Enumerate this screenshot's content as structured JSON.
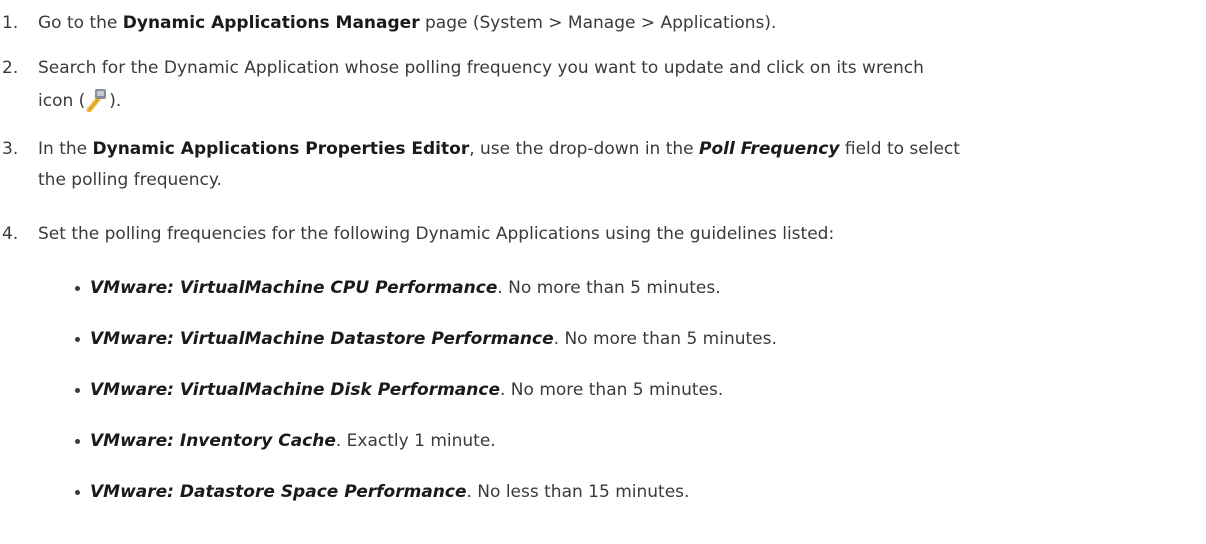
{
  "steps": [
    {
      "number": "1.",
      "before": "Go to the ",
      "bold": "Dynamic Applications Manager",
      "after": " page (System > Manage > Applications)."
    },
    {
      "number": "2.",
      "line1": "Search for the Dynamic Application whose polling frequency you want to update and click on its wrench",
      "line2_before": "icon (",
      "icon": "wrench-icon",
      "line2_after": ")."
    },
    {
      "number": "3.",
      "before": "In the ",
      "bold": "Dynamic Applications Properties Editor",
      "middle": ", use the drop-down in the ",
      "bold_italic": "Poll Frequency",
      "after": " field to select",
      "line2": "the polling frequency."
    },
    {
      "number": "4.",
      "text": "Set the polling frequencies for the following Dynamic Applications using the guidelines listed:"
    }
  ],
  "bullets": [
    {
      "name": "VMware: VirtualMachine CPU Performance",
      "guideline": ". No more than 5 minutes."
    },
    {
      "name": "VMware: VirtualMachine Datastore Performance",
      "guideline": ". No more than 5 minutes."
    },
    {
      "name": "VMware: VirtualMachine Disk Performance",
      "guideline": ". No more than 5 minutes."
    },
    {
      "name": "VMware: Inventory Cache",
      "guideline": ". Exactly 1 minute."
    },
    {
      "name": "VMware: Datastore Space Performance",
      "guideline": ". No less than 15 minutes."
    }
  ],
  "colors": {
    "text": "#3a3a3a",
    "emphasis": "#1a1a1a",
    "icon_accent": "#f2b01e"
  }
}
